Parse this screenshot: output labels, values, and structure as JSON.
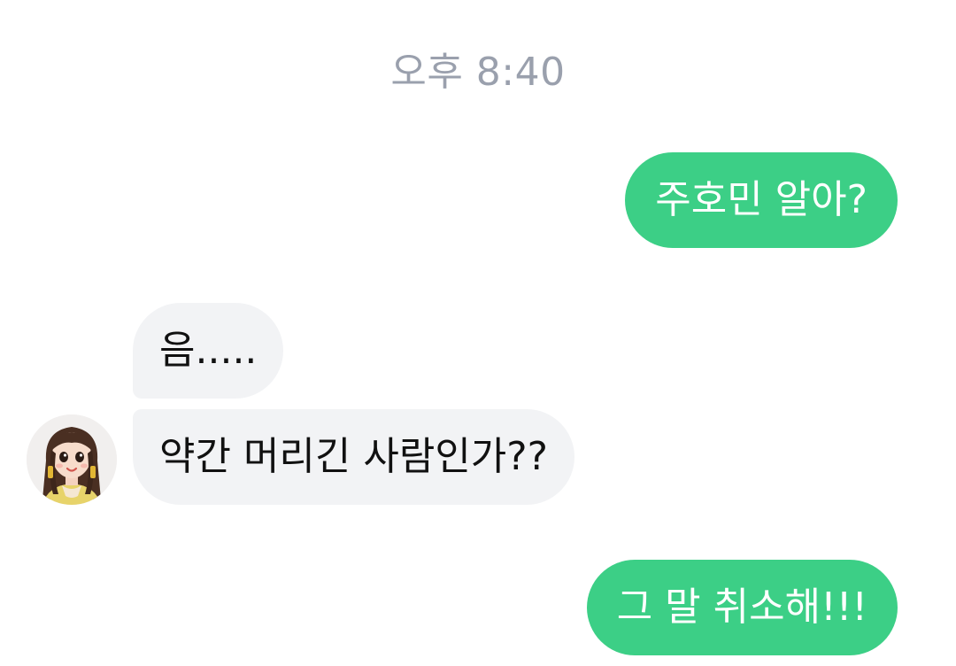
{
  "chat": {
    "timestamp": "오후 8:40",
    "messages": [
      {
        "sender": "me",
        "text": "주호민 알아?"
      },
      {
        "sender": "them",
        "text": "음....."
      },
      {
        "sender": "them",
        "text": "약간 머리긴 사람인가??"
      },
      {
        "sender": "me",
        "text": "그 말 취소해!!!"
      }
    ]
  },
  "colors": {
    "sent_bubble": "#3ccf86",
    "received_bubble": "#f2f3f5",
    "timestamp": "#9aa0ad"
  },
  "icons": {
    "contact_avatar": "avatar-illustration-girl"
  }
}
